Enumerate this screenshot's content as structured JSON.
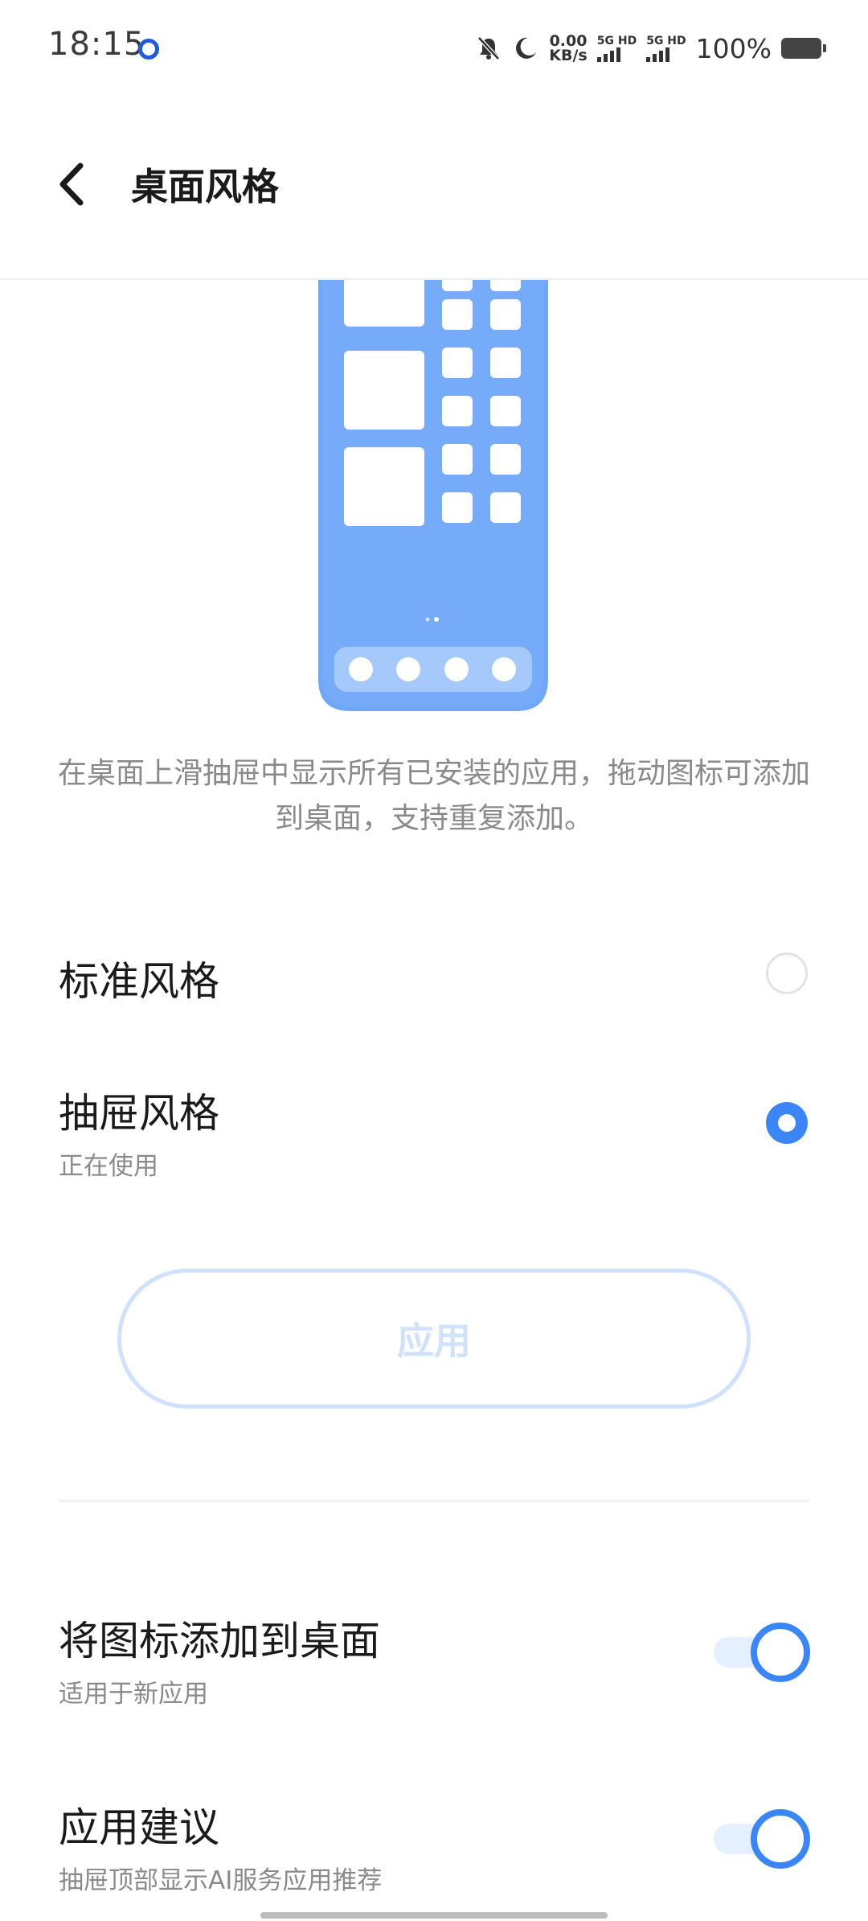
{
  "status_bar": {
    "time": "18:15",
    "net_speed_value": "0.00",
    "net_speed_unit": "KB/s",
    "sim1_label": "5G HD",
    "sim2_label": "5G HD",
    "battery": "100%"
  },
  "header": {
    "title": "桌面风格"
  },
  "description": "在桌面上滑抽屉中显示所有已安装的应用，拖动图标可添加到桌面，支持重复添加。",
  "options": [
    {
      "title": "标准风格",
      "subtitle": "",
      "selected": false
    },
    {
      "title": "抽屉风格",
      "subtitle": "正在使用",
      "selected": true
    }
  ],
  "apply_button": "应用",
  "settings": [
    {
      "title": "将图标添加到桌面",
      "subtitle": "适用于新应用",
      "enabled": true
    },
    {
      "title": "应用建议",
      "subtitle": "抽屉顶部显示AI服务应用推荐",
      "enabled": true
    }
  ],
  "colors": {
    "accent": "#3b86f7",
    "phone_illustration": "#70a8f8",
    "apply_disabled": "#cfe1fb"
  }
}
